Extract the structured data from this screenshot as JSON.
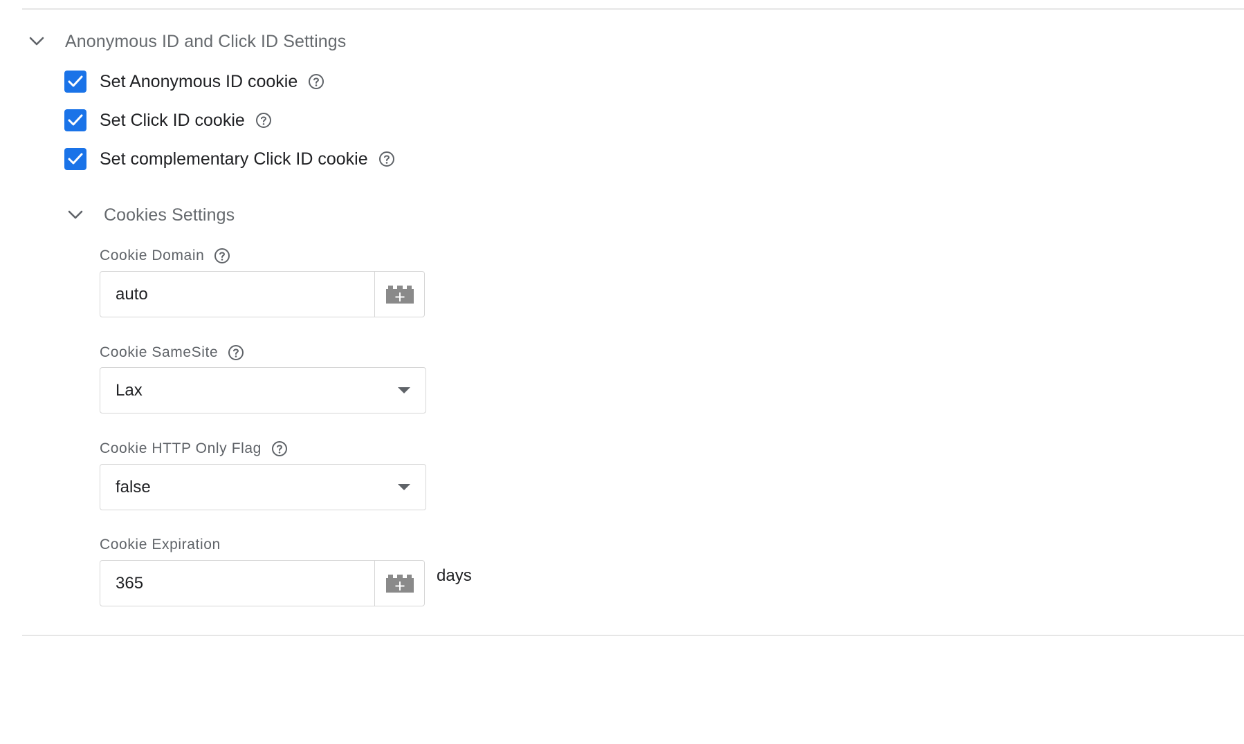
{
  "section": {
    "title": "Anonymous ID and Click ID Settings",
    "checkboxes": [
      {
        "label": "Set Anonymous ID cookie",
        "checked": true
      },
      {
        "label": "Set Click ID cookie",
        "checked": true
      },
      {
        "label": "Set complementary Click ID cookie",
        "checked": true
      }
    ]
  },
  "cookies": {
    "title": "Cookies Settings",
    "domain": {
      "label": "Cookie Domain",
      "value": "auto"
    },
    "samesite": {
      "label": "Cookie SameSite",
      "value": "Lax"
    },
    "http_only": {
      "label": "Cookie HTTP Only Flag",
      "value": "false"
    },
    "expiration": {
      "label": "Cookie Expiration",
      "value": "365",
      "suffix": "days"
    }
  },
  "colors": {
    "accent": "#1a73e8",
    "icon": "#5f6368",
    "border": "#d6d6d6"
  },
  "icons": {
    "collapse": "chevron-down-icon",
    "help": "help-circle-icon",
    "checkmark": "checkmark-icon",
    "variable": "variable-picker-icon",
    "dropdown": "dropdown-arrow-icon"
  }
}
